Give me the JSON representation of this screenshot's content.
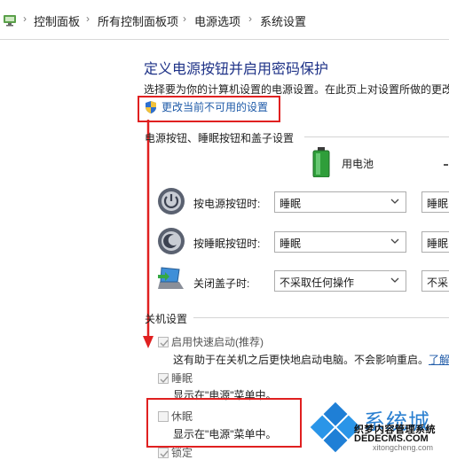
{
  "breadcrumb": {
    "icon": "control-panel-icon",
    "items": [
      "控制面板",
      "所有控制面板项",
      "电源选项",
      "系统设置"
    ],
    "separator": "›"
  },
  "page": {
    "title": "定义电源按钮并启用密码保护",
    "intro": "选择要为你的计算机设置的电源设置。在此页上对设置所做的更改",
    "change_link": "更改当前不可用的设置"
  },
  "power_section": {
    "heading": "电源按钮、睡眠按钮和盖子设置",
    "column_battery": "用电池",
    "rows": [
      {
        "icon": "power-button-icon",
        "label": "按电源按钮时:",
        "battery_value": "睡眠",
        "plugged_value": "睡眠"
      },
      {
        "icon": "sleep-button-icon",
        "label": "按睡眠按钮时:",
        "battery_value": "睡眠",
        "plugged_value": "睡眠"
      },
      {
        "icon": "laptop-lid-icon",
        "label": "关闭盖子时:",
        "battery_value": "不采取任何操作",
        "plugged_value": "不采"
      }
    ]
  },
  "shutdown_section": {
    "heading": "关机设置",
    "options": [
      {
        "label": "启用快速启动(推荐)",
        "checked": true,
        "enabled": false,
        "description": "这有助于在关机之后更快地启动电脑。不会影响重启。",
        "link": "了解"
      },
      {
        "label": "睡眠",
        "checked": true,
        "enabled": false,
        "description": "显示在\"电源\"菜单中。"
      },
      {
        "label": "休眠",
        "checked": false,
        "enabled": false,
        "description": "显示在\"电源\"菜单中。"
      },
      {
        "label": "锁定",
        "checked": true,
        "enabled": false,
        "description": ""
      }
    ]
  },
  "watermark": {
    "brand": "系统城",
    "line1": "织梦内容管理系统",
    "line2": "DEDECMS.COM",
    "line3": "xitongcheng.com"
  },
  "colors": {
    "title": "#1e3287",
    "link": "#1e5aa8",
    "highlight": "#e02020"
  }
}
